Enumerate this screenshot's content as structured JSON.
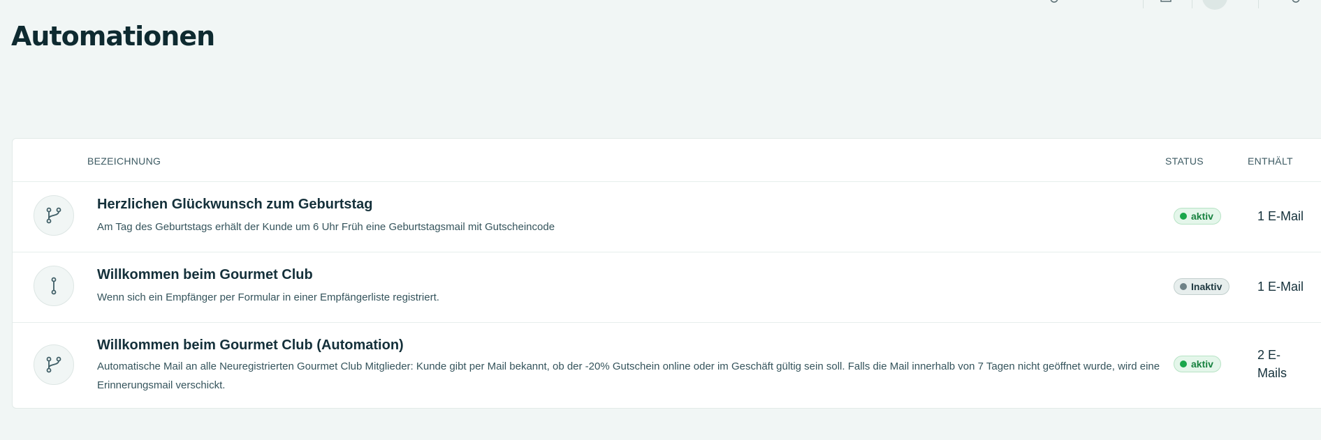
{
  "page": {
    "title": "Automationen"
  },
  "table": {
    "columns": {
      "name": "BEZEICHNUNG",
      "status": "STATUS",
      "contains": "ENTHÄLT"
    },
    "rows": [
      {
        "icon": "branch-icon",
        "title": "Herzlichen Glückwunsch zum Geburtstag",
        "description": "Am Tag des Geburtstags erhält der Kunde um 6 Uhr Früh eine Geburtstagsmail mit Gutscheincode",
        "status": "aktiv",
        "contains": "1 E-Mail"
      },
      {
        "icon": "linear-flow-icon",
        "title": "Willkommen beim Gourmet Club",
        "description": "Wenn sich ein Empfänger per Formular in einer Empfängerliste registriert.",
        "status": "Inaktiv",
        "contains": "1 E-Mail"
      },
      {
        "icon": "branch-icon",
        "title": "Willkommen beim Gourmet Club (Automation)",
        "description": "Automatische Mail an alle Neuregistrierten Gourmet Club Mitglieder: Kunde gibt per Mail bekannt, ob der -20% Gutschein online oder im Geschäft gültig sein soll. Falls die Mail innerhalb von 7 Tagen nicht geöffnet wurde, wird eine Erinnerungsmail verschickt.",
        "status": "aktiv",
        "contains": "2 E-Mails"
      }
    ]
  },
  "colors": {
    "active": "#19a64a",
    "inactive": "#6f8287",
    "background": "#f1f6f5"
  }
}
